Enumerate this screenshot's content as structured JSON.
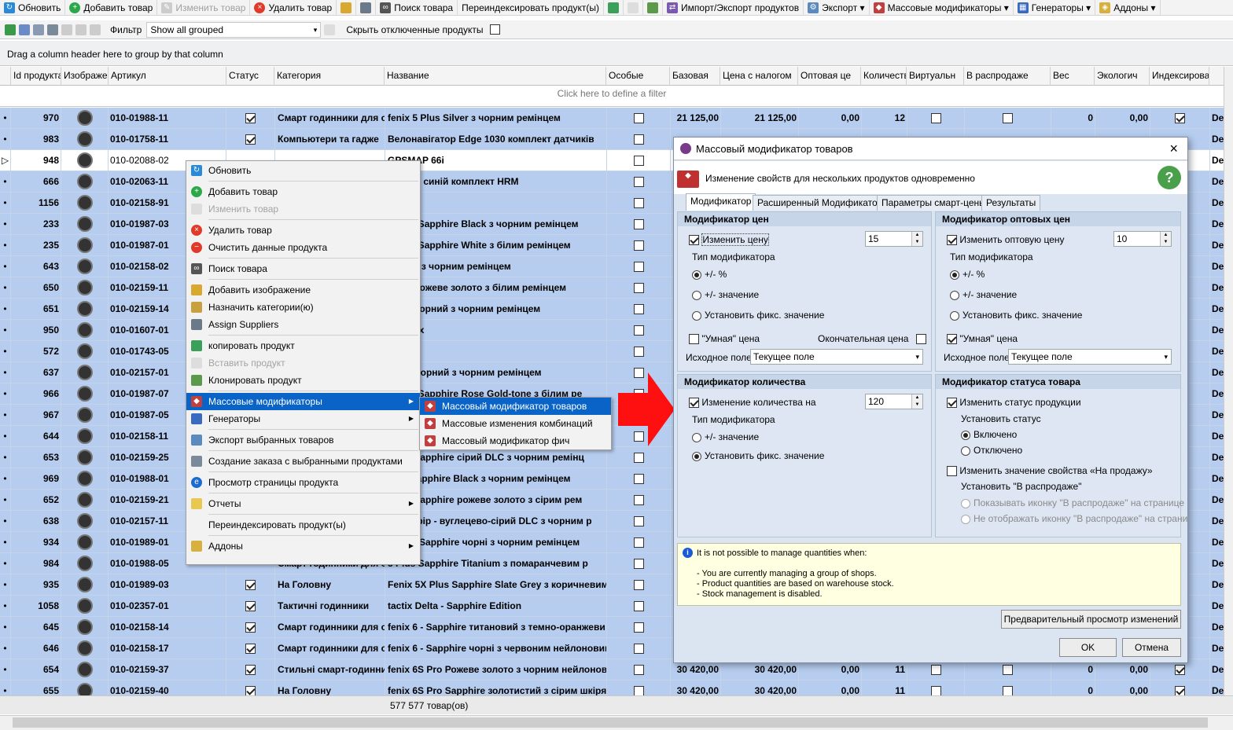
{
  "toolbar1": {
    "refresh": "Обновить",
    "add": "Добавить товар",
    "edit": "Изменить товар",
    "delete": "Удалить товар",
    "search": "Поиск товара",
    "reindex": "Переиндексировать продукт(ы)",
    "import_export": "Импорт/Экспорт продуктов",
    "export": "Экспорт",
    "mass": "Массовые модификаторы",
    "generators": "Генераторы",
    "addons": "Аддоны"
  },
  "toolbar2": {
    "filter_label": "Фильтр",
    "filter_value": "Show all grouped",
    "hide_disabled": "Скрыть отключенные продукты"
  },
  "group_hint": "Drag a column header here to group by that column",
  "filter_hint": "Click here to define a filter",
  "columns": [
    "Id продукта",
    "Изображен",
    "Артикул",
    "Статус",
    "Категория",
    "Название",
    "Особые",
    "Базовая",
    "Цена с налогом",
    "Оптовая це",
    "Количеств",
    "Виртуальн",
    "В распродаже",
    "Вес",
    "Экологич",
    "Индексирован"
  ],
  "rows": [
    {
      "id": "970",
      "sku": "010-01988-11",
      "cat": "Смарт годинники для с",
      "name": "fenix 5 Plus Silver з чорним ремінцем",
      "base": "21 125,00",
      "tax": "21 125,00",
      "whole": "0,00",
      "qty": "12",
      "w": "0",
      "eco": "0,00",
      "last": "De"
    },
    {
      "id": "983",
      "sku": "010-01758-11",
      "cat": "Компьютери та гадже",
      "name": "Велонавігатор Edge 1030 комплект датчиків",
      "base": "",
      "tax": "",
      "whole": "",
      "qty": "",
      "w": "",
      "eco": "",
      "last": "De"
    },
    {
      "id": "948",
      "sku": "010-02088-02",
      "cat": "",
      "name": "GPSMAP 66i",
      "base": "",
      "tax": "",
      "whole": "",
      "qty": "",
      "w": "",
      "eco": "",
      "last": "De"
    },
    {
      "id": "666",
      "sku": "010-02063-11",
      "cat": "",
      "name": "ner 945 синій комплект  HRM",
      "base": "",
      "tax": "",
      "whole": "",
      "qty": "",
      "w": "",
      "eco": "",
      "last": "De"
    },
    {
      "id": "1156",
      "sku": "010-02158-91",
      "cat": "",
      "name": "6",
      "base": "",
      "tax": "",
      "whole": "",
      "qty": "",
      "w": "",
      "eco": "",
      "last": "De"
    },
    {
      "id": "233",
      "sku": "010-01987-03",
      "cat": "",
      "name": "5 Plus Sapphire Black з чорним ремінцем",
      "base": "",
      "tax": "",
      "whole": "",
      "qty": "",
      "w": "",
      "eco": "",
      "last": "De"
    },
    {
      "id": "235",
      "sku": "010-01987-01",
      "cat": "",
      "name": "5 Plus Sapphire White з білим ремінцем",
      "base": "",
      "tax": "",
      "whole": "",
      "qty": "",
      "w": "",
      "eco": "",
      "last": "De"
    },
    {
      "id": "643",
      "sku": "010-02158-02",
      "cat": "",
      "name": "- чорні  з чорним ремінцем",
      "base": "",
      "tax": "",
      "whole": "",
      "qty": "",
      "w": "",
      "eco": "",
      "last": "De"
    },
    {
      "id": "650",
      "sku": "010-02159-11",
      "cat": "",
      "name": "5 Pro рожеве золото з білим ремінцем",
      "base": "",
      "tax": "",
      "whole": "",
      "qty": "",
      "w": "",
      "eco": "",
      "last": "De"
    },
    {
      "id": "651",
      "sku": "010-02159-14",
      "cat": "",
      "name": "5 Pro чорний з чорним ремінцем",
      "base": "",
      "tax": "",
      "whole": "",
      "qty": "",
      "w": "",
      "eco": "",
      "last": "De"
    },
    {
      "id": "950",
      "sku": "010-01607-01",
      "cat": "",
      "name": "P 276Cx",
      "base": "",
      "tax": "",
      "whole": "",
      "qty": "",
      "w": "",
      "eco": "",
      "last": "De"
    },
    {
      "id": "572",
      "sku": "010-01743-05",
      "cat": "",
      "name": "50",
      "base": "",
      "tax": "",
      "whole": "",
      "qty": "",
      "w": "",
      "eco": "",
      "last": "De"
    },
    {
      "id": "637",
      "sku": "010-02157-01",
      "cat": "",
      "name": "X Pro чорний з чорним ремінцем",
      "base": "",
      "tax": "",
      "whole": "",
      "qty": "",
      "w": "",
      "eco": "",
      "last": "De"
    },
    {
      "id": "966",
      "sku": "010-01987-07",
      "cat": "",
      "name": "5 Plus Sapphire Rose Gold-tone з білим ре",
      "base": "",
      "tax": "",
      "whole": "",
      "qty": "",
      "w": "",
      "eco": "",
      "last": "De"
    },
    {
      "id": "967",
      "sku": "010-01987-05",
      "cat": "",
      "name": "",
      "base": "",
      "tax": "",
      "whole": "",
      "qty": "",
      "w": "",
      "eco": "",
      "last": "De"
    },
    {
      "id": "644",
      "sku": "010-02158-11",
      "cat": "",
      "name": "",
      "base": "",
      "tax": "",
      "whole": "",
      "qty": "",
      "w": "",
      "eco": "",
      "last": "De"
    },
    {
      "id": "653",
      "sku": "010-02159-25",
      "cat": "",
      "name": "5 Pro Sapphire сірий DLC з чорним ремінц",
      "base": "",
      "tax": "",
      "whole": "",
      "qty": "",
      "w": "",
      "eco": "",
      "last": "De"
    },
    {
      "id": "969",
      "sku": "010-01988-01",
      "cat": "",
      "name": "Plus Sapphire Black з чорним ремінцем",
      "base": "",
      "tax": "",
      "whole": "",
      "qty": "",
      "w": "",
      "eco": "",
      "last": "De"
    },
    {
      "id": "652",
      "sku": "010-02159-21",
      "cat": "",
      "name": "5 Pro Sapphire рожеве золото з сірим рем",
      "base": "",
      "tax": "",
      "whole": "",
      "qty": "",
      "w": "",
      "eco": "",
      "last": "De"
    },
    {
      "id": "638",
      "sku": "010-02157-11",
      "cat": "",
      "name": "X Сапфір - вуглецево-сірий DLC з чорним р",
      "base": "",
      "tax": "",
      "whole": "",
      "qty": "",
      "w": "",
      "eco": "",
      "last": "De"
    },
    {
      "id": "934",
      "sku": "010-01989-01",
      "cat": "",
      "name": "X Plus Sapphire чорні з чорним ремінцем",
      "base": "",
      "tax": "",
      "whole": "",
      "qty": "",
      "w": "",
      "eco": "",
      "last": "De"
    },
    {
      "id": "984",
      "sku": "010-01988-05",
      "cat": "Смарт годинники для с",
      "name": "5 Plus Sapphire Titanium з помаранчевим р",
      "base": "",
      "tax": "",
      "whole": "",
      "qty": "",
      "w": "",
      "eco": "",
      "last": "De"
    },
    {
      "id": "935",
      "sku": "010-01989-03",
      "cat": "На Головну",
      "name": "Fenix 5X Plus Sapphire Slate Grey з коричневим ш",
      "base": "",
      "tax": "",
      "whole": "",
      "qty": "",
      "w": "",
      "eco": "",
      "last": "De"
    },
    {
      "id": "1058",
      "sku": "010-02357-01",
      "cat": "Тактичні годинники",
      "name": "tactix  Delta - Sapphire Edition",
      "base": "",
      "tax": "",
      "whole": "",
      "qty": "",
      "w": "",
      "eco": "",
      "last": "De"
    },
    {
      "id": "645",
      "sku": "010-02158-14",
      "cat": "Смарт годинники для с",
      "name": "fenix 6 - Sapphire титановий з темно-оранжеви",
      "base": "",
      "tax": "",
      "whole": "",
      "qty": "",
      "w": "",
      "eco": "",
      "last": "De"
    },
    {
      "id": "646",
      "sku": "010-02158-17",
      "cat": "Смарт годинники для с",
      "name": "fenix 6 - Sapphire чорні з червоним нейлоновим",
      "base": "",
      "tax": "",
      "whole": "",
      "qty": "",
      "w": "",
      "eco": "",
      "last": "De"
    },
    {
      "id": "654",
      "sku": "010-02159-37",
      "cat": "Стильні смарт-годинни",
      "name": "fenix 6S Pro Рожеве золото з чорним нейлонові",
      "base": "30 420,00",
      "tax": "30 420,00",
      "whole": "0,00",
      "qty": "11",
      "w": "0",
      "eco": "0,00",
      "last": "De"
    },
    {
      "id": "655",
      "sku": "010-02159-40",
      "cat": "На Головну",
      "name": "fenix 6S Pro Sapphire золотистий з сірим шкірян",
      "base": "30 420,00",
      "tax": "30 420,00",
      "whole": "0,00",
      "qty": "11",
      "w": "0",
      "eco": "0,00",
      "last": "De"
    }
  ],
  "status_count": "577 577 товар(ов)",
  "context_menu": [
    "Обновить",
    "Добавить товар",
    "Изменить товар",
    "Удалить товар",
    "Очистить данные продукта",
    "Поиск товара",
    "Добавить изображение",
    "Назначить категории(ю)",
    "Assign Suppliers",
    "копировать продукт",
    "Вставить продукт",
    "Клонировать продукт",
    "Массовые модификаторы",
    "Генераторы",
    "Экспорт выбранных товаров",
    "Создание заказа с выбранными продуктами",
    "Просмотр страницы продукта",
    "Отчеты",
    "Переиндексировать продукт(ы)",
    "Аддоны"
  ],
  "submenu": [
    "Массовый модификатор товаров",
    "Массовые изменения комбинаций",
    "Массовый модификатор фич"
  ],
  "dialog": {
    "title": "Массовый модификатор товаров",
    "subtitle": "Изменение свойств для нескольких продуктов одновременно",
    "tabs": [
      "Модификатор",
      "Расширенный Модификатор",
      "Параметры смарт-цены",
      "Результаты"
    ],
    "price": {
      "header": "Модификатор цен",
      "change": "Изменить цену",
      "value": "15",
      "type_label": "Тип модификатора",
      "opt1": "+/- %",
      "opt2": "+/- значение",
      "opt3": "Установить фикс. значение",
      "smart": "\"Умная\" цена",
      "final": "Окончательная цена",
      "src_label": "Исходное поле",
      "src_value": "Текущее поле"
    },
    "wholesale": {
      "header": "Модификатор оптовых цен",
      "change": "Изменить оптовую цену",
      "value": "10",
      "type_label": "Тип модификатора",
      "opt1": "+/- %",
      "opt2": "+/- значение",
      "opt3": "Установить фикс. значение",
      "smart": "\"Умная\" цена",
      "src_label": "Исходное поле",
      "src_value": "Текущее поле"
    },
    "qty": {
      "header": "Модификатор количества",
      "change": "Изменение количества на",
      "value": "120",
      "type_label": "Тип модификатора",
      "opt1": "+/- значение",
      "opt2": "Установить фикс. значение"
    },
    "status": {
      "header": "Модификатор статуса товара",
      "change": "Изменить статус продукции",
      "set_label": "Установить статус",
      "on": "Включено",
      "off": "Отключено",
      "sale_change": "Изменить значение свойства «На продажу»",
      "sale_label": "Установить \"В распродаже\"",
      "sale_opt1": "Показывать иконку \"В распродаже\" на странице",
      "sale_opt2": "Не отображать иконку \"В распродаже\" на страни"
    },
    "info": {
      "title": "It is not possible to manage quantities when:",
      "l1": "- You are currently managing a group of shops.",
      "l2": "- Product quantities are based on warehouse stock.",
      "l3": "- Stock management is disabled."
    },
    "preview": "Предварительный просмотр изменений",
    "ok": "OK",
    "cancel": "Отмена"
  },
  "colors": {
    "selection": "#b6cdef",
    "highlight": "#0a64c8",
    "arrow": "#ff1010",
    "dialog_bg": "#dbe5f1"
  }
}
